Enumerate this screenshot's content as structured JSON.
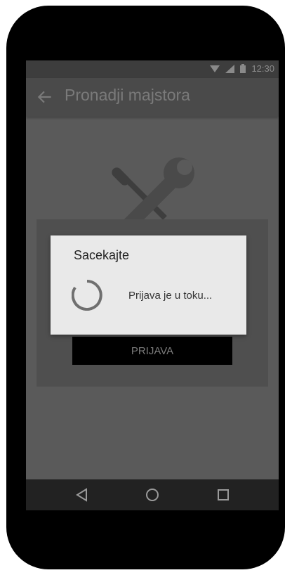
{
  "status_bar": {
    "time": "12:30",
    "icons": [
      "wifi-icon",
      "signal-icon",
      "battery-icon"
    ]
  },
  "app_bar": {
    "title": "Pronadji majstora",
    "nav_icon": "back-arrow-icon"
  },
  "background": {
    "logo_icon": "tools-icon",
    "button_label": "PRIJAVA"
  },
  "dialog": {
    "title": "Sacekajte",
    "message": "Prijava je u toku..."
  },
  "nav_bar": {
    "icons": [
      "back-triangle-icon",
      "home-circle-icon",
      "recents-square-icon"
    ]
  }
}
